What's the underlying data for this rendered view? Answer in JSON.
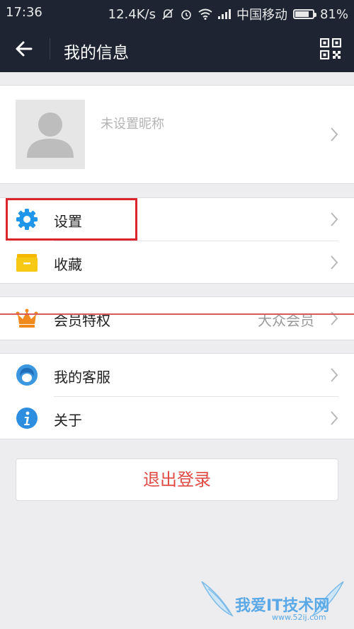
{
  "status_bar": {
    "time": "17:36",
    "speed": "12.4K/s",
    "carrier": "中国移动",
    "battery": "81%",
    "battery_level": 0.81
  },
  "header": {
    "title": "我的信息",
    "back_icon": "back-arrow-icon",
    "qr_icon": "qr-code-icon"
  },
  "profile": {
    "nickname": "未设置昵称",
    "avatar_icon": "default-avatar-icon"
  },
  "menu_group1": [
    {
      "label": "设置",
      "icon": "gear-icon",
      "color": "#1e96ea"
    },
    {
      "label": "收藏",
      "icon": "folder-icon",
      "color": "#f7c814"
    }
  ],
  "menu_group2": [
    {
      "label": "会员特权",
      "value": "大众会员",
      "icon": "crown-icon",
      "color": "#f08a1f"
    }
  ],
  "menu_group3": [
    {
      "label": "我的客服",
      "icon": "customer-service-icon",
      "color": "#3a97e0"
    },
    {
      "label": "关于",
      "icon": "info-icon",
      "color": "#2d8ee0"
    }
  ],
  "logout_label": "退出登录",
  "watermark": {
    "text": "我爱IT技术网",
    "url": "www.52ij.com"
  },
  "colors": {
    "header_bg": "#1f2433",
    "accent_red": "#e04a44",
    "highlight_box": "#d9252b",
    "page_bg": "#ededf0"
  }
}
